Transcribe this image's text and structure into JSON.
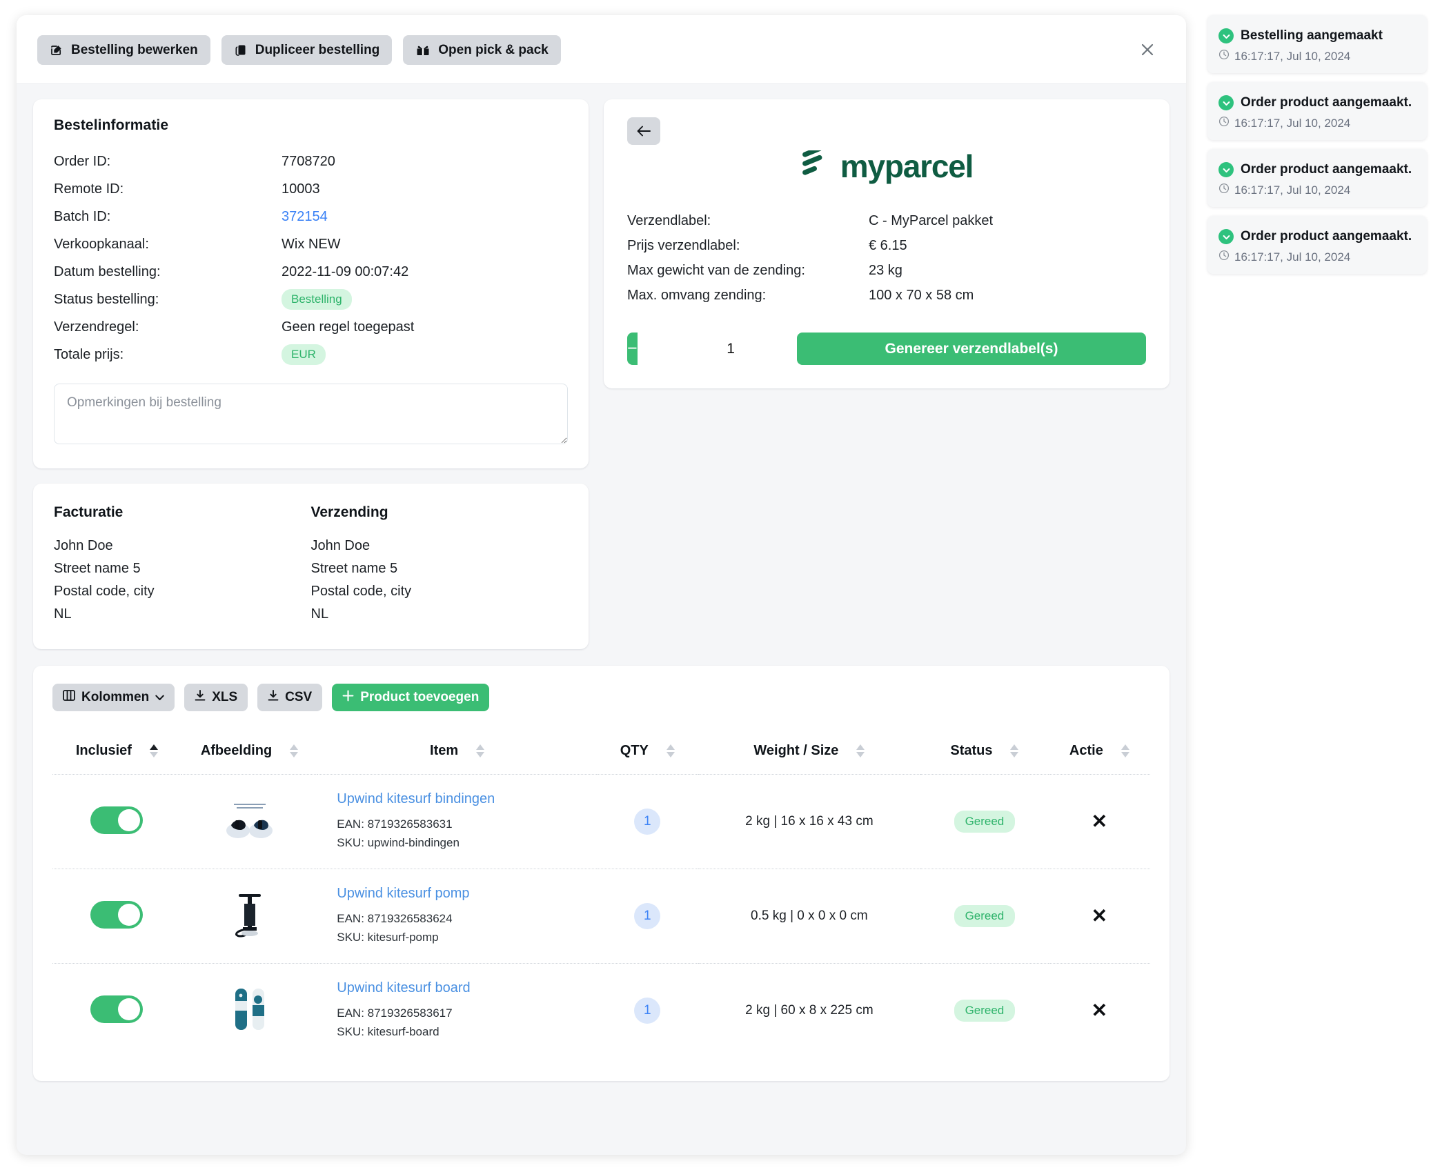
{
  "header": {
    "actions": [
      {
        "label": "Bestelling bewerken",
        "icon": "edit-square-icon"
      },
      {
        "label": "Dupliceer bestelling",
        "icon": "copy-icon"
      },
      {
        "label": "Open pick & pack",
        "icon": "open-box-icon"
      }
    ],
    "close_label": "×"
  },
  "order_info": {
    "title": "Bestelinformatie",
    "rows": [
      {
        "label": "Order ID:",
        "value": "7708720",
        "type": "text"
      },
      {
        "label": "Remote ID:",
        "value": "10003",
        "type": "text"
      },
      {
        "label": "Batch ID:",
        "value": "372154",
        "type": "link"
      },
      {
        "label": "Verkoopkanaal:",
        "value": "Wix NEW",
        "type": "text"
      },
      {
        "label": "Datum bestelling:",
        "value": "2022-11-09 00:07:42",
        "type": "text"
      },
      {
        "label": "Status bestelling:",
        "value": "Bestelling",
        "type": "pill"
      },
      {
        "label": "Verzendregel:",
        "value": "Geen regel toegepast",
        "type": "text"
      },
      {
        "label": "Totale prijs:",
        "value": "EUR",
        "type": "pill"
      }
    ],
    "notes_placeholder": "Opmerkingen bij bestelling",
    "notes_value": ""
  },
  "addresses": {
    "billing": {
      "title": "Facturatie",
      "lines": [
        "John Doe",
        "Street name 5",
        "Postal code, city",
        "NL"
      ]
    },
    "shipping": {
      "title": "Verzending",
      "lines": [
        "John Doe",
        "Street name 5",
        "Postal code, city",
        "NL"
      ]
    }
  },
  "myparcel": {
    "back_label": "←",
    "brand": "myparcel",
    "rows": [
      {
        "label": "Verzendlabel:",
        "value": "C - MyParcel pakket"
      },
      {
        "label": "Prijs verzendlabel:",
        "value": "€ 6.15"
      },
      {
        "label": "Max gewicht van de zending:",
        "value": "23 kg"
      },
      {
        "label": "Max. omvang zending:",
        "value": "100 x 70 x 58 cm"
      }
    ],
    "qty_decrement": "−",
    "qty_value": "1",
    "qty_increment": "+",
    "generate_label": "Genereer verzendlabel(s)"
  },
  "products": {
    "toolbar": {
      "columns_label": "Kolommen",
      "columns_caret": "⌄",
      "xls_label": "XLS",
      "csv_label": "CSV",
      "add_product_label": "Product toevoegen",
      "add_icon": "plus-icon"
    },
    "columns": [
      "Inclusief",
      "Afbeelding",
      "Item",
      "QTY",
      "Weight / Size",
      "Status",
      "Actie"
    ],
    "sorted_column_index": 0,
    "rows": [
      {
        "included": true,
        "image_alt": "kitesurf-bindings-thumbnail",
        "name": "Upwind kitesurf bindingen",
        "ean": "EAN: 8719326583631",
        "sku": "SKU: upwind-bindingen",
        "qty": "1",
        "weight_size": "2 kg | 16 x 16 x 43 cm",
        "status": "Gereed",
        "action": "✕"
      },
      {
        "included": true,
        "image_alt": "kitesurf-pump-thumbnail",
        "name": "Upwind kitesurf pomp",
        "ean": "EAN: 8719326583624",
        "sku": "SKU: kitesurf-pomp",
        "qty": "1",
        "weight_size": "0.5 kg | 0 x 0 x 0 cm",
        "status": "Gereed",
        "action": "✕"
      },
      {
        "included": true,
        "image_alt": "kitesurf-board-thumbnail",
        "name": "Upwind kitesurf board",
        "ean": "EAN: 8719326583617",
        "sku": "SKU: kitesurf-board",
        "qty": "1",
        "weight_size": "2 kg | 60 x 8 x 225 cm",
        "status": "Gereed",
        "action": "✕"
      }
    ]
  },
  "toasts": [
    {
      "title": "Bestelling aangemaakt",
      "time": "16:17:17, Jul 10, 2024"
    },
    {
      "title": "Order product aangemaakt.",
      "time": "16:17:17, Jul 10, 2024"
    },
    {
      "title": "Order product aangemaakt.",
      "time": "16:17:17, Jul 10, 2024"
    },
    {
      "title": "Order product aangemaakt.",
      "time": "16:17:17, Jul 10, 2024"
    }
  ],
  "colors": {
    "accent_green": "#3bbd74",
    "brand_dark_green": "#0f5c42",
    "link_blue": "#4a90e2",
    "chip_gray": "#d6d9de",
    "status_bg": "#d4f5e0",
    "status_fg": "#2db36a"
  }
}
